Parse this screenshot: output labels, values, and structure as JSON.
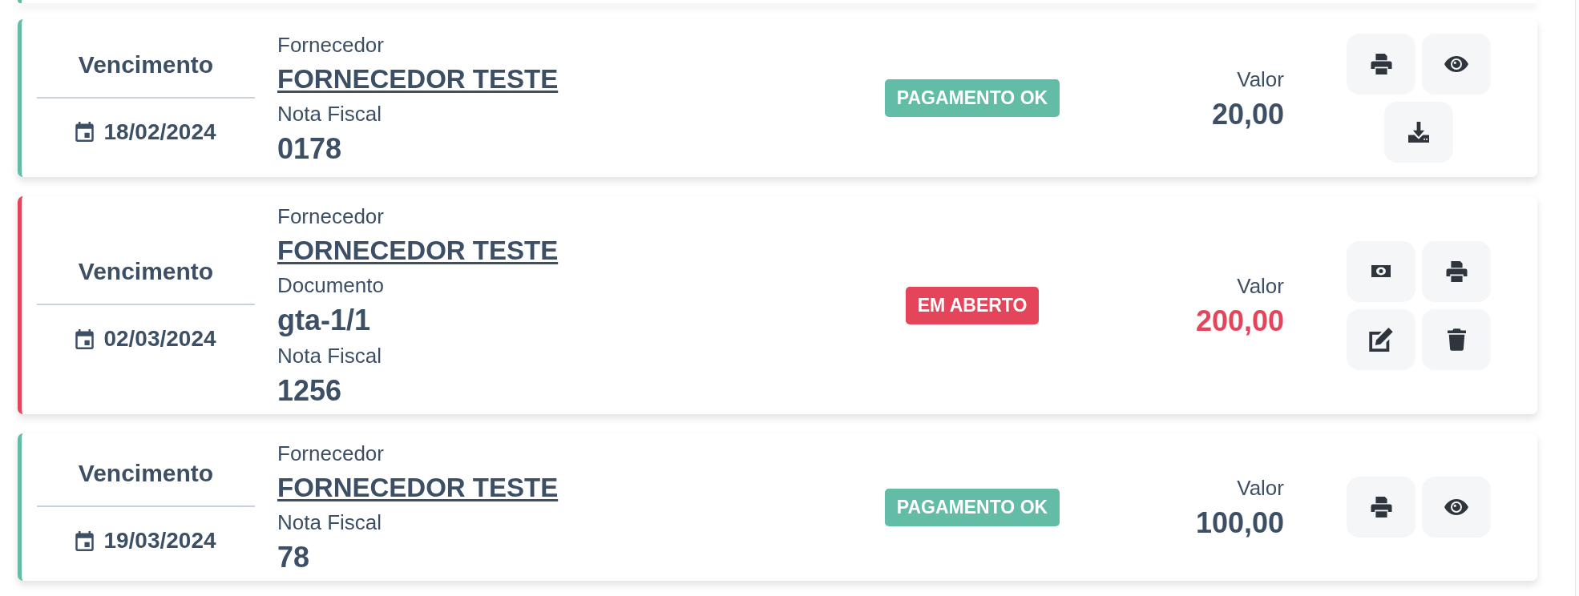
{
  "previous_card": {
    "color": "#63bca5"
  },
  "cards": [
    {
      "color": "#63bca5",
      "unpaid": false,
      "due_label": "Vencimento",
      "due_date": "18/02/2024",
      "fields": [
        {
          "kind": "link",
          "label": "Fornecedor",
          "value": "FORNECEDOR TESTE"
        },
        {
          "kind": "text",
          "label": "Nota Fiscal",
          "value": "0178"
        }
      ],
      "badge": "PAGAMENTO OK",
      "amount_label": "Valor",
      "amount": "20,00",
      "actions": [
        {
          "kind": "print"
        },
        {
          "kind": "view"
        },
        {
          "kind": "download"
        }
      ]
    },
    {
      "color": "#e4455b",
      "unpaid": true,
      "due_label": "Vencimento",
      "due_date": "02/03/2024",
      "fields": [
        {
          "kind": "link",
          "label": "Fornecedor",
          "value": "FORNECEDOR TESTE"
        },
        {
          "kind": "text",
          "label": "Documento",
          "value": "gta-1/1"
        },
        {
          "kind": "text",
          "label": "Nota Fiscal",
          "value": "1256"
        }
      ],
      "badge": "EM ABERTO",
      "amount_label": "Valor",
      "amount": "200,00",
      "actions": [
        {
          "kind": "pay"
        },
        {
          "kind": "print"
        },
        {
          "kind": "edit"
        },
        {
          "kind": "delete"
        }
      ]
    },
    {
      "color": "#63bca5",
      "unpaid": false,
      "due_label": "Vencimento",
      "due_date": "19/03/2024",
      "fields": [
        {
          "kind": "link",
          "label": "Fornecedor",
          "value": "FORNECEDOR TESTE"
        },
        {
          "kind": "text",
          "label": "Nota Fiscal",
          "value": "78"
        }
      ],
      "badge": "PAGAMENTO OK",
      "amount_label": "Valor",
      "amount": "100,00",
      "actions": [
        {
          "kind": "print"
        },
        {
          "kind": "view"
        }
      ]
    }
  ]
}
